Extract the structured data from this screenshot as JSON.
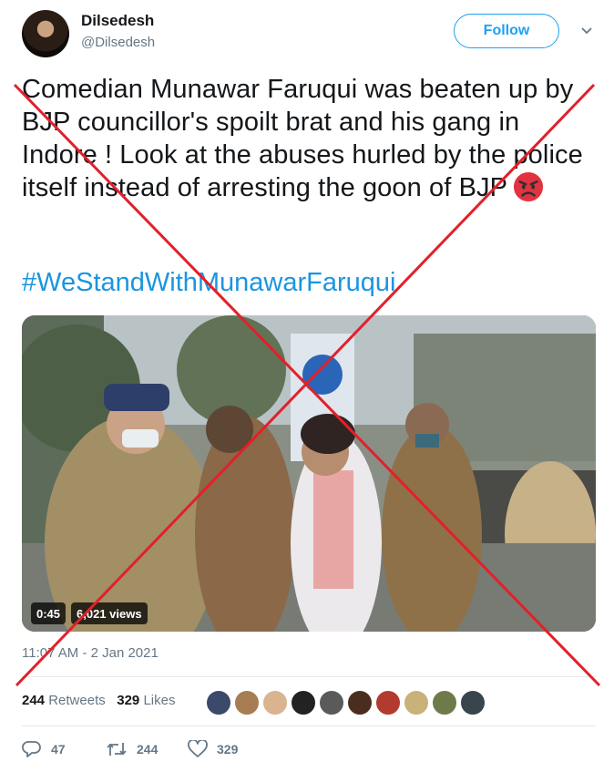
{
  "user": {
    "name": "Dilsedesh",
    "handle": "@Dilsedesh"
  },
  "header": {
    "follow_label": "Follow"
  },
  "tweet": {
    "text": "Comedian Munawar Faruqui was beaten up by BJP councillor's spoilt brat and his gang in Indore  ! Look at the abuses hurled by the police itself instead of arresting the goon of BJP",
    "hashtag": "#WeStandWithMunawarFaruqui",
    "timestamp": "11:07 AM - 2 Jan 2021"
  },
  "video": {
    "duration": "0:45",
    "views": "6,021 views"
  },
  "stats": {
    "retweets_count": "244",
    "retweets_label": "Retweets",
    "likes_count": "329",
    "likes_label": "Likes"
  },
  "actions": {
    "replies": "47",
    "retweets": "244",
    "likes": "329"
  },
  "overlay": {
    "color": "#e3202a"
  },
  "icons": [
    "chevron-down-icon",
    "angry-face-icon",
    "reply-icon",
    "retweet-icon",
    "heart-icon"
  ]
}
